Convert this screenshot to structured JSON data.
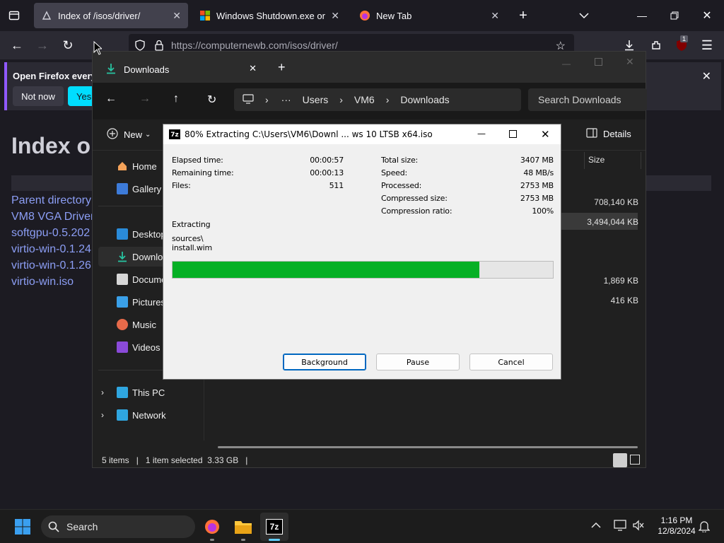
{
  "firefox": {
    "tabs": [
      {
        "title": "Index of /isos/driver/",
        "active": true
      },
      {
        "title": "Windows Shutdown.exe or shut",
        "active": false
      },
      {
        "title": "New Tab",
        "active": false
      }
    ],
    "url": "https://computernewb.com/isos/driver/",
    "extension_badge": "1",
    "notification": {
      "text": "Open Firefox every",
      "not_now": "Not now",
      "yes": "Yes,"
    },
    "page": {
      "heading": "Index o",
      "links": [
        "Parent directory",
        "VM8 VGA Driver",
        "softgpu-0.5.202",
        "virtio-win-0.1.24",
        "virtio-win-0.1.26",
        "virtio-win.iso"
      ]
    }
  },
  "explorer": {
    "tab_title": "Downloads",
    "breadcrumb": [
      "Users",
      "VM6",
      "Downloads"
    ],
    "search_placeholder": "Search Downloads",
    "new_label": "New",
    "details_label": "Details",
    "column_size": "Size",
    "sizes": [
      "708,140 KB",
      "3,494,044 KB",
      "1,869 KB",
      "416 KB"
    ],
    "sidebar": [
      {
        "label": "Home",
        "icon": "home-icon"
      },
      {
        "label": "Gallery",
        "icon": "gallery-icon"
      },
      {
        "label": "Desktop",
        "icon": "desktop-icon"
      },
      {
        "label": "Downloads",
        "icon": "downloads-icon"
      },
      {
        "label": "Documents",
        "icon": "documents-icon"
      },
      {
        "label": "Pictures",
        "icon": "pictures-icon"
      },
      {
        "label": "Music",
        "icon": "music-icon"
      },
      {
        "label": "Videos",
        "icon": "videos-icon"
      },
      {
        "label": "This PC",
        "icon": "this-pc-icon"
      },
      {
        "label": "Network",
        "icon": "network-icon"
      }
    ],
    "status": {
      "items": "5 items",
      "selected": "1 item selected  3.33 GB"
    }
  },
  "zip": {
    "title": "80% Extracting C:\\Users\\VM6\\Downl ... ws 10 LTSB x64.iso",
    "left_stats": [
      {
        "label": "Elapsed time:",
        "value": "00:00:57"
      },
      {
        "label": "Remaining time:",
        "value": "00:00:13"
      },
      {
        "label": "Files:",
        "value": "511"
      }
    ],
    "right_stats": [
      {
        "label": "Total size:",
        "value": "3407 MB"
      },
      {
        "label": "Speed:",
        "value": "48 MB/s"
      },
      {
        "label": "Processed:",
        "value": "2753 MB"
      },
      {
        "label": "Compressed size:",
        "value": "2753 MB"
      },
      {
        "label": "Compression ratio:",
        "value": "100%"
      }
    ],
    "operation": "Extracting",
    "current_path": "sources\\",
    "current_file": "install.wim",
    "progress": 0.807,
    "buttons": {
      "background": "Background",
      "pause": "Pause",
      "cancel": "Cancel"
    },
    "colors": {
      "progress": "#06b025"
    }
  },
  "taskbar": {
    "search_placeholder": "Search",
    "time": "1:16 PM",
    "date": "12/8/2024"
  }
}
